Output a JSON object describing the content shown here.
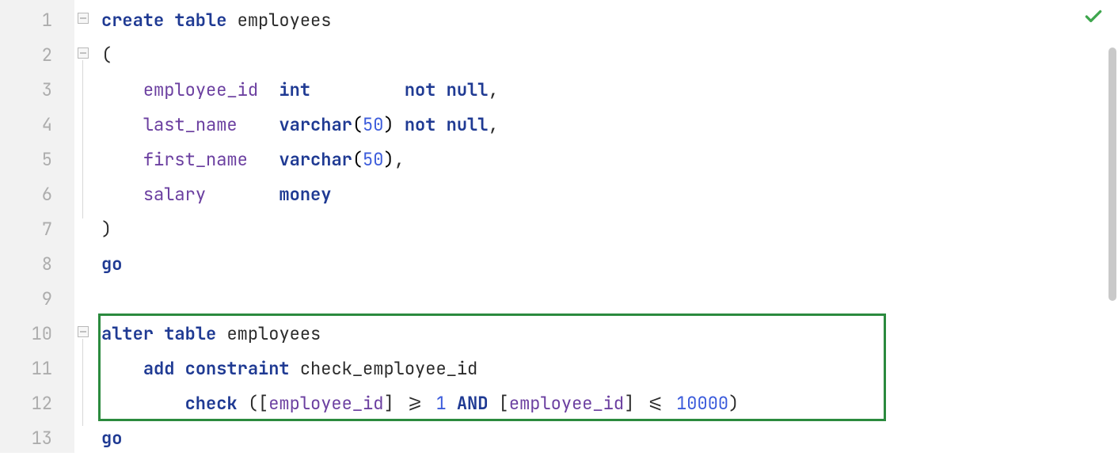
{
  "gutter": {
    "lines": [
      "1",
      "2",
      "3",
      "4",
      "5",
      "6",
      "7",
      "8",
      "9",
      "10",
      "11",
      "12",
      "13"
    ]
  },
  "code": {
    "l1": {
      "create": "create",
      "table": "table",
      "name": "employees"
    },
    "l2": {
      "open": "("
    },
    "l3": {
      "col": "employee_id",
      "type": "int",
      "notnull": "not null",
      "comma": ","
    },
    "l4": {
      "col": "last_name",
      "type": "varchar",
      "arg": "50",
      "notnull": "not null",
      "comma": ","
    },
    "l5": {
      "col": "first_name",
      "type": "varchar",
      "arg": "50",
      "comma": ","
    },
    "l6": {
      "col": "salary",
      "type": "money"
    },
    "l7": {
      "close": ")"
    },
    "l8": {
      "go": "go"
    },
    "l10": {
      "alter": "alter",
      "table": "table",
      "name": "employees"
    },
    "l11": {
      "add": "add",
      "constraint": "constraint",
      "cname": "check_employee_id"
    },
    "l12": {
      "check": "check",
      "open": "(",
      "lb1": "[",
      "col1": "employee_id",
      "rb1": "]",
      "op1": ">=",
      "v1": "1",
      "and": "AND",
      "lb2": "[",
      "col2": "employee_id",
      "rb2": "]",
      "op2": "<=",
      "v2": "10000",
      "close": ")"
    },
    "l13": {
      "go": "go"
    }
  },
  "status": {
    "ok": "ok"
  }
}
